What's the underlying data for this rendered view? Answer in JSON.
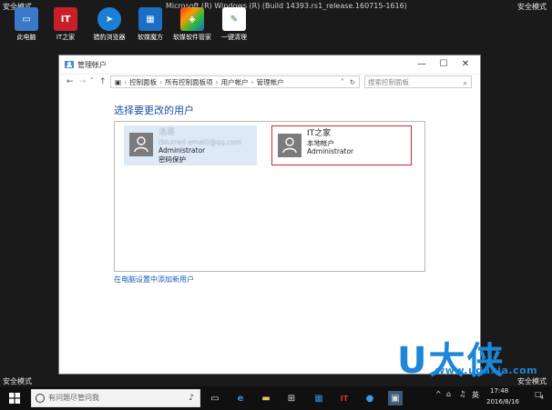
{
  "desktop": {
    "safe_mode_label": "安全模式",
    "title_text": "Microsoft (R) Windows (R) (Build 14393.rs1_release.160715-1616)",
    "icons": [
      {
        "label": "此电脑",
        "icon": "computer-icon",
        "color": "#3a78c9"
      },
      {
        "label": "IT之家",
        "icon": "ithome-icon",
        "color": "#c8202a"
      },
      {
        "label": "猎豹浏览器",
        "icon": "browser-icon",
        "color": "#1b7fd6"
      },
      {
        "label": "软媒魔方",
        "icon": "cube-icon",
        "color": "#1a6fc4"
      },
      {
        "label": "软媒软件管家",
        "icon": "software-manager-icon",
        "color": "#2c9a44"
      },
      {
        "label": "一键清理",
        "icon": "cleaner-icon",
        "color": "#e9b12a"
      }
    ]
  },
  "window": {
    "title": "管理帐户",
    "minimize": "—",
    "maximize": "☐",
    "close": "✕",
    "nav": {
      "back": "←",
      "forward": "→",
      "dropdown": "˅",
      "up": "↑"
    },
    "breadcrumb": [
      "控制面板",
      "所有控制面板项",
      "用户帐户",
      "管理帐户"
    ],
    "refresh": "↻",
    "search_placeholder": "搜索控制面板",
    "heading": "选择要更改的用户",
    "users": [
      {
        "name": "浩哥",
        "email": "(blurred email)@qq.com",
        "role": "Administrator",
        "extra": "密码保护",
        "selected": false
      },
      {
        "name": "IT之家",
        "type": "本地帐户",
        "role": "Administrator",
        "selected": true
      }
    ],
    "add_user_link": "在电脑设置中添加新用户"
  },
  "watermark": {
    "big": "U大侠",
    "url": "www.udaxia.com"
  },
  "taskbar": {
    "search_placeholder": "有问题尽管问我",
    "tray_lang": "英",
    "tray_time": "17:48",
    "tray_date": "2016/8/16",
    "tray_notif": "4"
  }
}
